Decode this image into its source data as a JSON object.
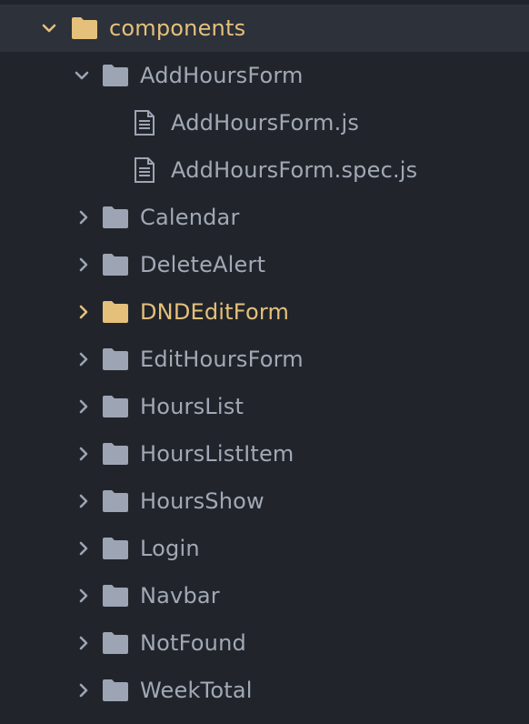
{
  "tree": {
    "root": {
      "label": "components",
      "icon": "folder-icon",
      "expanded": true,
      "color": "#e5c07b"
    },
    "items": [
      {
        "label": "AddHoursForm",
        "type": "folder",
        "expanded": true
      },
      {
        "label": "AddHoursForm.js",
        "type": "file"
      },
      {
        "label": "AddHoursForm.spec.js",
        "type": "file"
      },
      {
        "label": "Calendar",
        "type": "folder",
        "expanded": false
      },
      {
        "label": "DeleteAlert",
        "type": "folder",
        "expanded": false
      },
      {
        "label": "DNDEditForm",
        "type": "folder",
        "expanded": false,
        "highlight": true
      },
      {
        "label": "EditHoursForm",
        "type": "folder",
        "expanded": false
      },
      {
        "label": "HoursList",
        "type": "folder",
        "expanded": false
      },
      {
        "label": "HoursListItem",
        "type": "folder",
        "expanded": false
      },
      {
        "label": "HoursShow",
        "type": "folder",
        "expanded": false
      },
      {
        "label": "Login",
        "type": "folder",
        "expanded": false
      },
      {
        "label": "Navbar",
        "type": "folder",
        "expanded": false
      },
      {
        "label": "NotFound",
        "type": "folder",
        "expanded": false
      },
      {
        "label": "WeekTotal",
        "type": "folder",
        "expanded": false
      }
    ]
  },
  "colors": {
    "background": "#21252b",
    "selected_row": "#2c313a",
    "text": "#a2a9b6",
    "icon": "#9da5b4",
    "accent": "#e5c07b"
  }
}
